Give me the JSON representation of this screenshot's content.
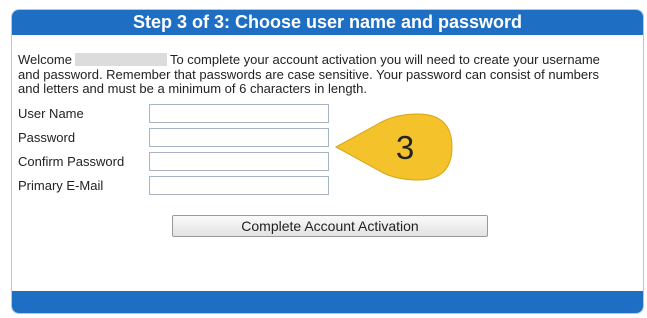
{
  "header": {
    "title": "Step 3 of 3: Choose user name and password"
  },
  "intro": {
    "welcome": "Welcome",
    "text": "To complete your account activation you will need to create your username and password. Remember that passwords are case sensitive. Your password can consist of numbers and letters and must be a minimum of 6 characters in length."
  },
  "form": {
    "fields": [
      {
        "label": "User Name",
        "value": ""
      },
      {
        "label": "Password",
        "value": ""
      },
      {
        "label": "Confirm Password",
        "value": ""
      },
      {
        "label": "Primary E-Mail",
        "value": ""
      }
    ],
    "submit_label": "Complete Account Activation"
  },
  "callout": {
    "number": "3"
  },
  "colors": {
    "header_blue": "#1e6fc4",
    "callout_yellow": "#f4c22b"
  }
}
